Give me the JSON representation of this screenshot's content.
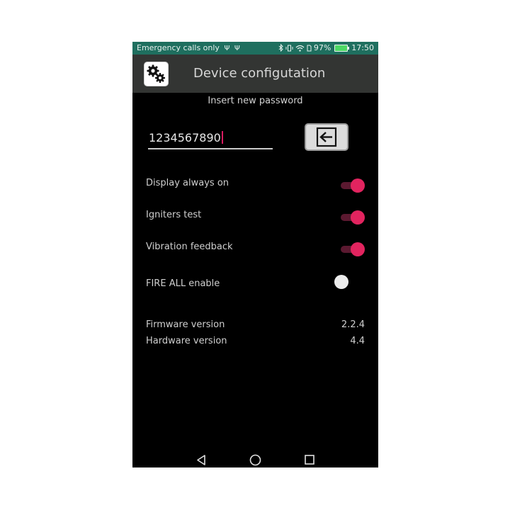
{
  "status_bar": {
    "carrier_text": "Emergency calls only",
    "battery_percent": "97%",
    "time": "17:50",
    "icons": [
      "usb-icon",
      "usb-icon",
      "bluetooth-icon",
      "vibrate-icon",
      "wifi-icon",
      "sim-icon",
      "battery-icon"
    ]
  },
  "app_bar": {
    "title": "Device configutation",
    "icon": "gears-icon"
  },
  "password": {
    "label": "Insert new password",
    "value": "1234567890",
    "enter_icon": "enter-arrow-icon"
  },
  "settings": [
    {
      "label": "Display always on",
      "enabled": true
    },
    {
      "label": "Igniters test",
      "enabled": true
    },
    {
      "label": "Vibration feedback",
      "enabled": true
    },
    {
      "label": "FIRE ALL enable",
      "enabled": false
    }
  ],
  "versions": {
    "firmware_label": "Firmware version",
    "firmware_value": "2.2.4",
    "hardware_label": "Hardware version",
    "hardware_value": "4.4"
  },
  "nav_bar": {
    "icons": [
      "back-icon",
      "home-icon",
      "recents-icon"
    ]
  },
  "colors": {
    "status_bar": "#1f6f5f",
    "app_bar": "#333533",
    "accent": "#e2245f"
  }
}
